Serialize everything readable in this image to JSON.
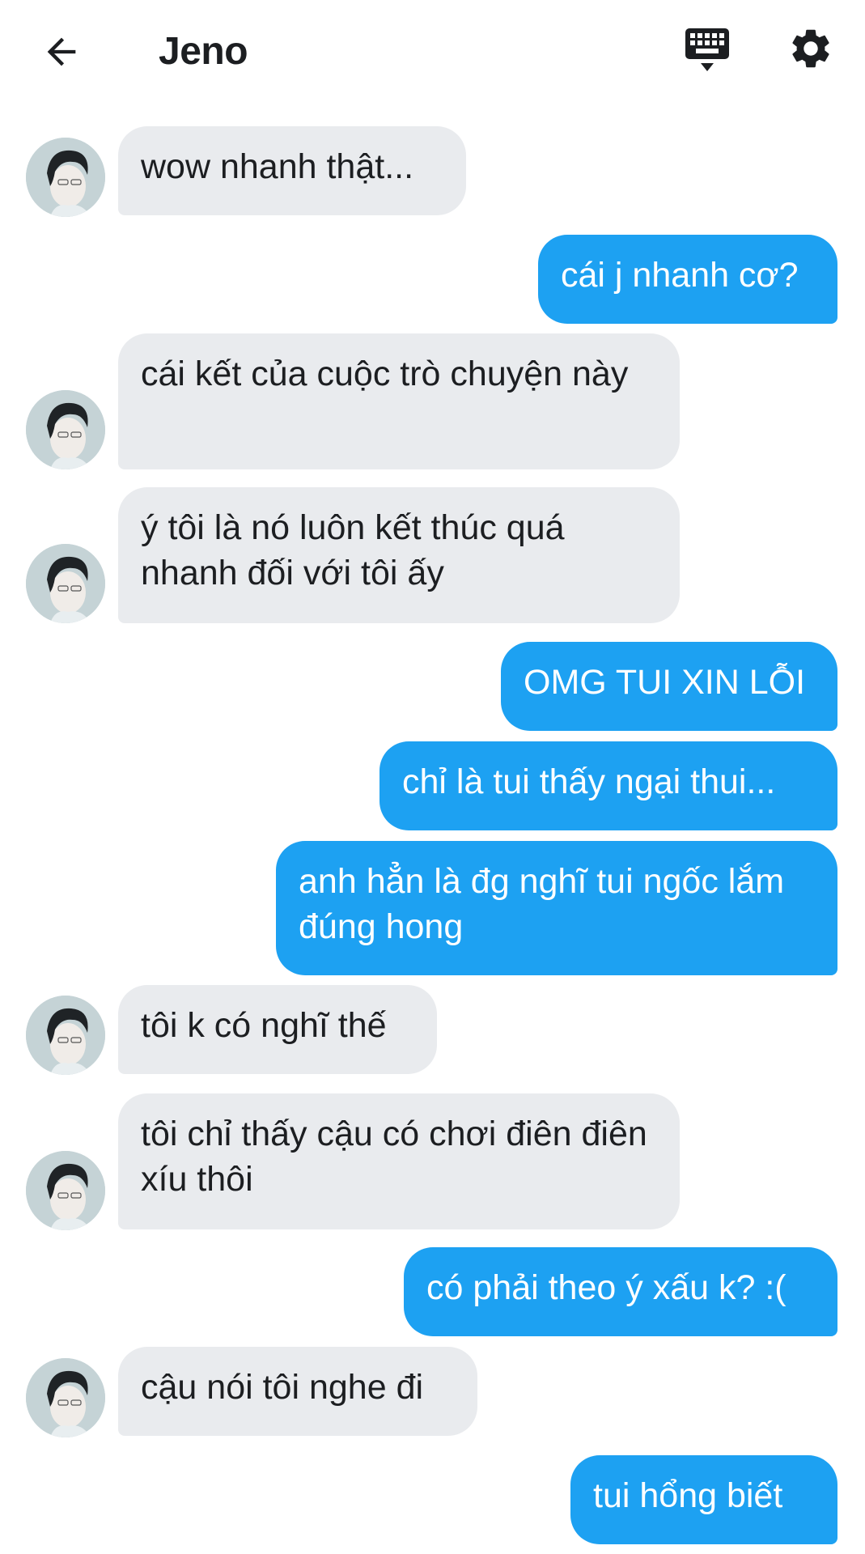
{
  "header": {
    "title": "Jeno",
    "icons": [
      "arrow-left-icon",
      "keyboard-icon",
      "gear-icon"
    ]
  },
  "messages": [
    {
      "side": "in",
      "text": "wow nhanh thật..."
    },
    {
      "side": "out",
      "text": "cái j nhanh cơ?"
    },
    {
      "side": "in",
      "text": "cái kết của cuộc trò chuyện này"
    },
    {
      "side": "in",
      "text": "ý tôi là nó luôn kết thúc quá nhanh đối với tôi ấy"
    },
    {
      "side": "out",
      "text": "OMG TUI XIN LỖI"
    },
    {
      "side": "out",
      "text": "chỉ là tui thấy ngại thui..."
    },
    {
      "side": "out",
      "text": "anh hẳn là đg nghĩ tui ngốc lắm đúng hong"
    },
    {
      "side": "in",
      "text": "tôi k có nghĩ thế"
    },
    {
      "side": "in",
      "text": "tôi chỉ thấy cậu có chơi điên điên xíu thôi"
    },
    {
      "side": "out",
      "text": "có phải theo ý xấu k? :("
    },
    {
      "side": "in",
      "text": "cậu nói tôi nghe đi"
    },
    {
      "side": "out",
      "text": "tui hổng biết"
    }
  ],
  "colors": {
    "outgoing_bubble": "#1da1f2",
    "incoming_bubble": "#e9ebee",
    "text_dark": "#1c1e21"
  }
}
